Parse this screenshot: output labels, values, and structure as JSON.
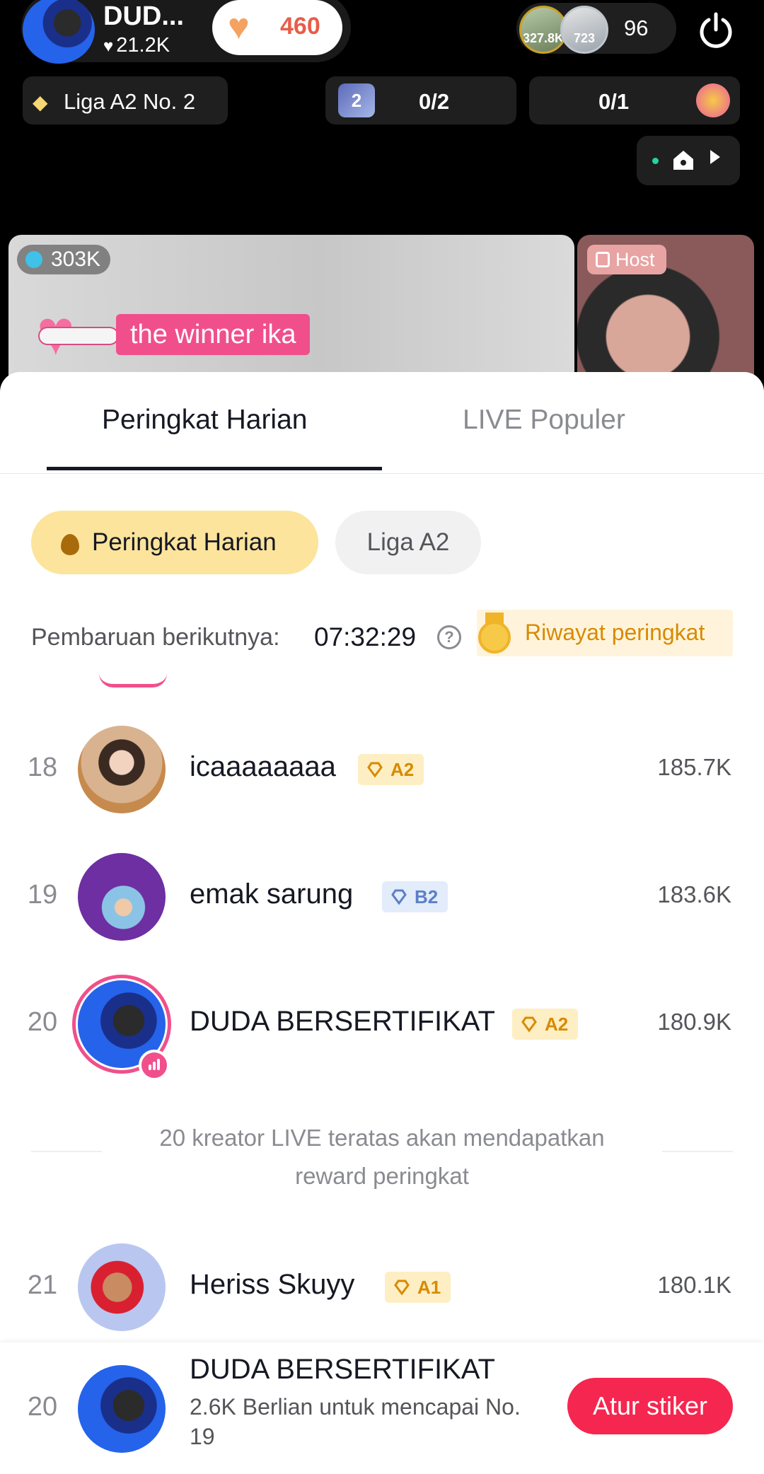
{
  "live": {
    "host_name": "DUD...",
    "host_likes": "21.2K",
    "coin_count": "460",
    "viewer_avatar_1_label": "327.8K",
    "viewer_avatar_2_label": "723",
    "viewer_count": "96",
    "league_label": "Liga A2 No. 2",
    "quest_1_progress": "0/2",
    "quest_1_icon_text": "2",
    "quest_2_progress": "0/1",
    "main_viewers": "303K",
    "winner_banner": "the winner ika",
    "guest_tag": "Host"
  },
  "tabs": {
    "daily": "Peringkat Harian",
    "live": "LIVE Populer"
  },
  "filters": {
    "daily": "Peringkat Harian",
    "league": "Liga A2"
  },
  "refresh": {
    "label": "Pembaruan berikutnya:",
    "time": "07:32:29",
    "help": "?",
    "history": "Riwayat peringkat"
  },
  "ranking": [
    {
      "rank": "18",
      "name": "icaaaaaaaa",
      "badge": "A2",
      "badge_color": "gold",
      "score": "185.7K"
    },
    {
      "rank": "19",
      "name": "emak sarung",
      "badge": "B2",
      "badge_color": "blue",
      "score": "183.6K"
    },
    {
      "rank": "20",
      "name": "DUDA BERSERTIFIKAT",
      "badge": "A2",
      "badge_color": "gold",
      "score": "180.9K"
    },
    {
      "rank": "21",
      "name": "Heriss Skuyy",
      "badge": "A1",
      "badge_color": "gold",
      "score": "180.1K"
    }
  ],
  "reward_note": {
    "line1": "20 kreator LIVE teratas akan mendapatkan",
    "line2": "reward peringkat"
  },
  "my_rank": {
    "rank": "20",
    "name": "DUDA BERSERTIFIKAT",
    "subtitle": "2.6K Berlian untuk mencapai No. 19",
    "button": "Atur stiker"
  },
  "colors": {
    "accent_pink": "#f04f8c",
    "button_red": "#f5264f",
    "chip_yellow": "#fde49c",
    "badge_gold": "#d88a00",
    "badge_blue": "#5b7fc8"
  }
}
